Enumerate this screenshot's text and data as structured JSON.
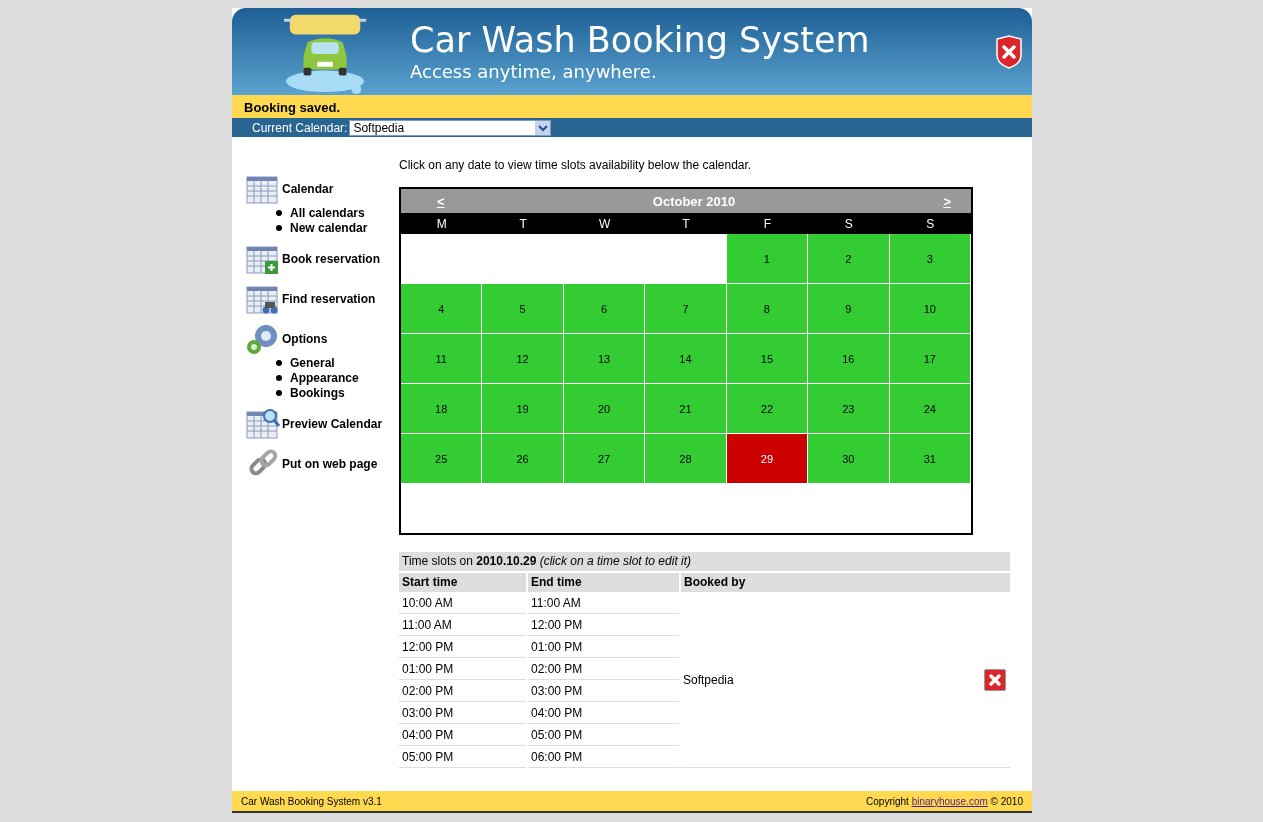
{
  "header": {
    "title": "Car Wash Booking System",
    "subtitle": "Access anytime, anywhere."
  },
  "status_message": "Booking saved.",
  "calendar_selector": {
    "label": "Current Calendar:",
    "value": "Softpedia"
  },
  "sidebar": [
    {
      "label": "Calendar",
      "children": [
        "All calendars",
        "New calendar"
      ]
    },
    {
      "label": "Book reservation"
    },
    {
      "label": "Find reservation"
    },
    {
      "label": "Options",
      "children": [
        "General",
        "Appearance",
        "Bookings"
      ]
    },
    {
      "label": "Preview Calendar"
    },
    {
      "label": "Put on web page"
    }
  ],
  "instruction": "Click on any date to view time slots availability below the calendar.",
  "calendar": {
    "prev": "<",
    "title": "October 2010",
    "next": ">",
    "weekdays": [
      "M",
      "T",
      "W",
      "T",
      "F",
      "S",
      "S"
    ],
    "weeks": [
      [
        {
          "kind": "blank"
        },
        {
          "kind": "blank"
        },
        {
          "kind": "blank"
        },
        {
          "kind": "blank"
        },
        {
          "day": "1",
          "selected": false
        },
        {
          "day": "2",
          "selected": false
        },
        {
          "day": "3",
          "selected": false
        }
      ],
      [
        {
          "day": "4",
          "selected": false
        },
        {
          "day": "5",
          "selected": false
        },
        {
          "day": "6",
          "selected": false
        },
        {
          "day": "7",
          "selected": false
        },
        {
          "day": "8",
          "selected": false
        },
        {
          "day": "9",
          "selected": false
        },
        {
          "day": "10",
          "selected": false
        }
      ],
      [
        {
          "day": "11",
          "selected": false
        },
        {
          "day": "12",
          "selected": false
        },
        {
          "day": "13",
          "selected": false
        },
        {
          "day": "14",
          "selected": false
        },
        {
          "day": "15",
          "selected": false
        },
        {
          "day": "16",
          "selected": false
        },
        {
          "day": "17",
          "selected": false
        }
      ],
      [
        {
          "day": "18",
          "selected": false
        },
        {
          "day": "19",
          "selected": false
        },
        {
          "day": "20",
          "selected": false
        },
        {
          "day": "21",
          "selected": false
        },
        {
          "day": "22",
          "selected": false
        },
        {
          "day": "23",
          "selected": false
        },
        {
          "day": "24",
          "selected": false
        }
      ],
      [
        {
          "day": "25",
          "selected": false
        },
        {
          "day": "26",
          "selected": false
        },
        {
          "day": "27",
          "selected": false
        },
        {
          "day": "28",
          "selected": false
        },
        {
          "day": "29",
          "selected": true
        },
        {
          "day": "30",
          "selected": false
        },
        {
          "day": "31",
          "selected": false
        }
      ]
    ]
  },
  "time_slots": {
    "caption": "Time slots on **2010.10.29** *(click on a time slot to edit it)*",
    "columns": [
      "Start time",
      "End time",
      "Booked by"
    ],
    "rows": [
      {
        "start": "10:00 AM",
        "end": "11:00 AM"
      },
      {
        "start": "11:00 AM",
        "end": "12:00 PM"
      },
      {
        "start": "12:00 PM",
        "end": "01:00 PM"
      },
      {
        "start": "01:00 PM",
        "end": "02:00 PM"
      },
      {
        "start": "02:00 PM",
        "end": "03:00 PM"
      },
      {
        "start": "03:00 PM",
        "end": "04:00 PM"
      },
      {
        "start": "04:00 PM",
        "end": "05:00 PM"
      },
      {
        "start": "05:00 PM",
        "end": "06:00 PM"
      }
    ],
    "booked_by": "Softpedia"
  },
  "footer": {
    "version": "Car Wash Booking System v3.1",
    "copyright": "Copyright",
    "link": "binaryhouse.com",
    "suffix": "© 2010"
  }
}
